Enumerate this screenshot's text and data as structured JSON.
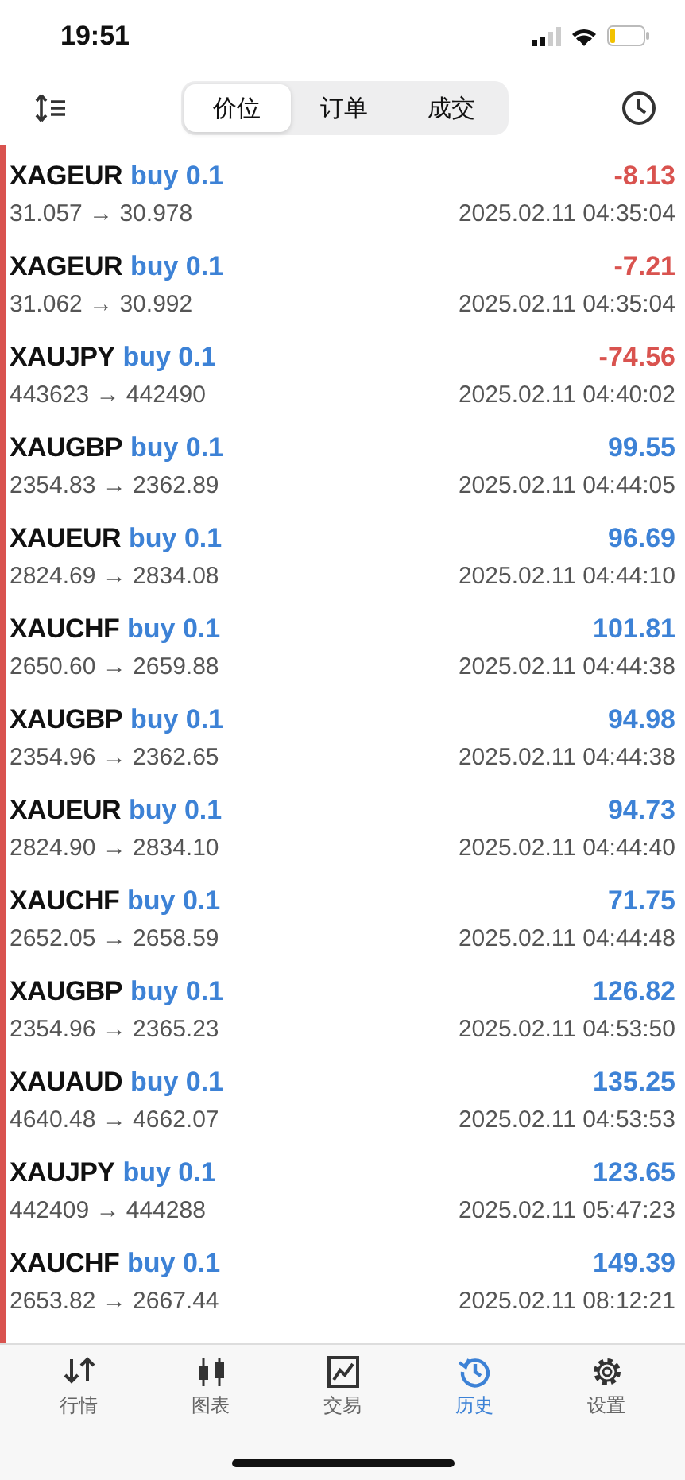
{
  "status_bar": {
    "time": "19:51"
  },
  "segments": [
    {
      "label": "价位",
      "selected": true
    },
    {
      "label": "订单",
      "selected": false
    },
    {
      "label": "成交",
      "selected": false
    }
  ],
  "deals": [
    {
      "symbol": "XAGEUR",
      "side": "buy 0.1",
      "prices": "31.057 → 30.978",
      "profit": "-8.13",
      "color": "#d9534f",
      "time": "2025.02.11 04:35:04"
    },
    {
      "symbol": "XAGEUR",
      "side": "buy 0.1",
      "prices": "31.062 → 30.992",
      "profit": "-7.21",
      "color": "#d9534f",
      "time": "2025.02.11 04:35:04"
    },
    {
      "symbol": "XAUJPY",
      "side": "buy 0.1",
      "prices": "443623 → 442490",
      "profit": "-74.56",
      "color": "#d9534f",
      "time": "2025.02.11 04:40:02"
    },
    {
      "symbol": "XAUGBP",
      "side": "buy 0.1",
      "prices": "2354.83 → 2362.89",
      "profit": "99.55",
      "color": "#3d82d6",
      "time": "2025.02.11 04:44:05"
    },
    {
      "symbol": "XAUEUR",
      "side": "buy 0.1",
      "prices": "2824.69 → 2834.08",
      "profit": "96.69",
      "color": "#3d82d6",
      "time": "2025.02.11 04:44:10"
    },
    {
      "symbol": "XAUCHF",
      "side": "buy 0.1",
      "prices": "2650.60 → 2659.88",
      "profit": "101.81",
      "color": "#3d82d6",
      "time": "2025.02.11 04:44:38"
    },
    {
      "symbol": "XAUGBP",
      "side": "buy 0.1",
      "prices": "2354.96 → 2362.65",
      "profit": "94.98",
      "color": "#3d82d6",
      "time": "2025.02.11 04:44:38"
    },
    {
      "symbol": "XAUEUR",
      "side": "buy 0.1",
      "prices": "2824.90 → 2834.10",
      "profit": "94.73",
      "color": "#3d82d6",
      "time": "2025.02.11 04:44:40"
    },
    {
      "symbol": "XAUCHF",
      "side": "buy 0.1",
      "prices": "2652.05 → 2658.59",
      "profit": "71.75",
      "color": "#3d82d6",
      "time": "2025.02.11 04:44:48"
    },
    {
      "symbol": "XAUGBP",
      "side": "buy 0.1",
      "prices": "2354.96 → 2365.23",
      "profit": "126.82",
      "color": "#3d82d6",
      "time": "2025.02.11 04:53:50"
    },
    {
      "symbol": "XAUAUD",
      "side": "buy 0.1",
      "prices": "4640.48 → 4662.07",
      "profit": "135.25",
      "color": "#3d82d6",
      "time": "2025.02.11 04:53:53"
    },
    {
      "symbol": "XAUJPY",
      "side": "buy 0.1",
      "prices": "442409 → 444288",
      "profit": "123.65",
      "color": "#3d82d6",
      "time": "2025.02.11 05:47:23"
    },
    {
      "symbol": "XAUCHF",
      "side": "buy 0.1",
      "prices": "2653.82 → 2667.44",
      "profit": "149.39",
      "color": "#3d82d6",
      "time": "2025.02.11 08:12:21"
    }
  ],
  "tab_bar": [
    {
      "label": "行情",
      "kind": "quotes",
      "selected": false
    },
    {
      "label": "图表",
      "kind": "chart",
      "selected": false
    },
    {
      "label": "交易",
      "kind": "trade",
      "selected": false
    },
    {
      "label": "历史",
      "kind": "history",
      "selected": true
    },
    {
      "label": "设置",
      "kind": "settings",
      "selected": false
    }
  ]
}
